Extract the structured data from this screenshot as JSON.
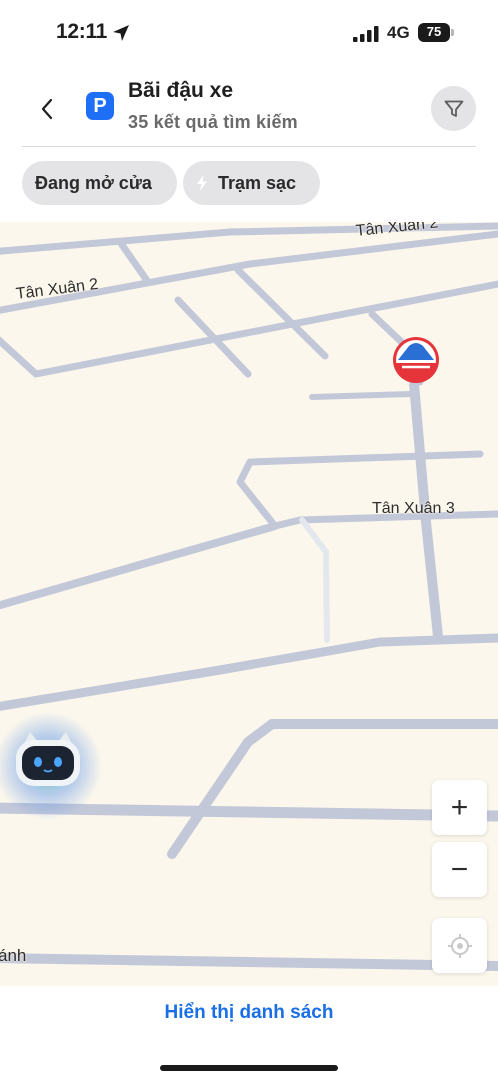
{
  "status": {
    "time": "12:11",
    "network": "4G",
    "battery": "75"
  },
  "header": {
    "title": "Bãi đậu xe",
    "subtitle": "35 kết quả tìm kiếm",
    "parking_glyph": "P"
  },
  "filters": [
    {
      "label": "Đang mở cửa",
      "icon": null
    },
    {
      "label": "Trạm sạc",
      "icon": "lightning-bolt-icon"
    }
  ],
  "map": {
    "streets": [
      "Tân Xuân 2",
      "Tân Xuân 2",
      "Tân Xuân 3",
      "ánh"
    ],
    "zoom_in_symbol": "+",
    "zoom_out_symbol": "−",
    "road_color": "#c3c8d9",
    "background_color": "#fbf7ec"
  },
  "bottom": {
    "list_link": "Hiển thị danh sách"
  },
  "colors": {
    "accent": "#1a6fe6",
    "parking_blue": "#1e6ff5",
    "chip_bg": "#e4e4e6"
  }
}
